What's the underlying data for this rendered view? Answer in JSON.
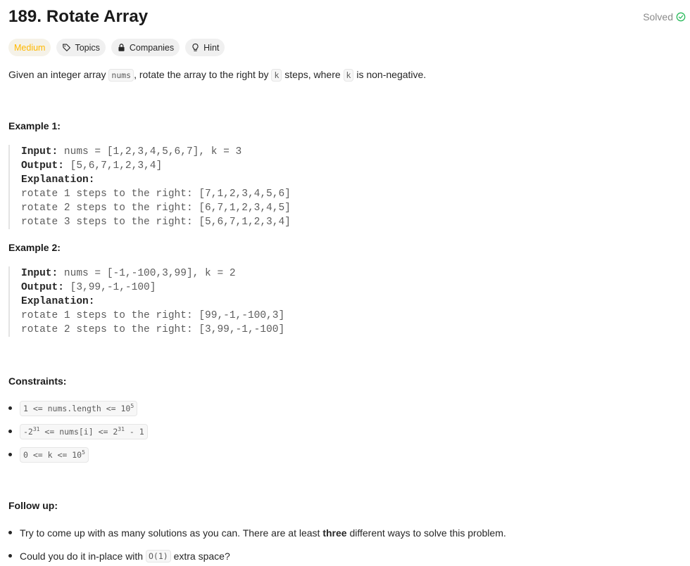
{
  "problem": {
    "title": "189. Rotate Array",
    "status": "Solved"
  },
  "tags": {
    "difficulty": "Medium",
    "topics": "Topics",
    "companies": "Companies",
    "hint": "Hint"
  },
  "description": {
    "part1": "Given an integer array ",
    "code1": "nums",
    "part2": ", rotate the array to the right by ",
    "code2": "k",
    "part3": " steps, where ",
    "code3": "k",
    "part4": " is non-negative."
  },
  "example1": {
    "title": "Example 1:",
    "input_label": "Input:",
    "input_value": " nums = [1,2,3,4,5,6,7], k = 3",
    "output_label": "Output:",
    "output_value": " [5,6,7,1,2,3,4]",
    "explanation_label": "Explanation:",
    "lines": [
      "rotate 1 steps to the right: [7,1,2,3,4,5,6]",
      "rotate 2 steps to the right: [6,7,1,2,3,4,5]",
      "rotate 3 steps to the right: [5,6,7,1,2,3,4]"
    ]
  },
  "example2": {
    "title": "Example 2:",
    "input_label": "Input:",
    "input_value": " nums = [-1,-100,3,99], k = 2",
    "output_label": "Output:",
    "output_value": " [3,99,-1,-100]",
    "explanation_label": "Explanation:",
    "lines": [
      "rotate 1 steps to the right: [99,-1,-100,3]",
      "rotate 2 steps to the right: [3,99,-1,-100]"
    ]
  },
  "constraints": {
    "title": "Constraints:",
    "c1_a": "1 <= nums.length <= 10",
    "c1_sup": "5",
    "c2_a": "-2",
    "c2_sup1": "31",
    "c2_b": " <= nums[i] <= 2",
    "c2_sup2": "31",
    "c2_c": " - 1",
    "c3_a": "0 <= k <= 10",
    "c3_sup": "5"
  },
  "followup": {
    "title": "Follow up:",
    "item1_a": "Try to come up with as many solutions as you can. There are at least ",
    "item1_bold": "three",
    "item1_b": " different ways to solve this problem.",
    "item2_a": "Could you do it in-place with ",
    "item2_code": "O(1)",
    "item2_b": " extra space?"
  },
  "colors": {
    "medium": "#ffb800",
    "solved_check": "#2cbb5d"
  },
  "icons": {
    "solved": "check-circle-icon",
    "topics": "tag-icon",
    "companies": "lock-icon",
    "hint": "lightbulb-icon"
  }
}
